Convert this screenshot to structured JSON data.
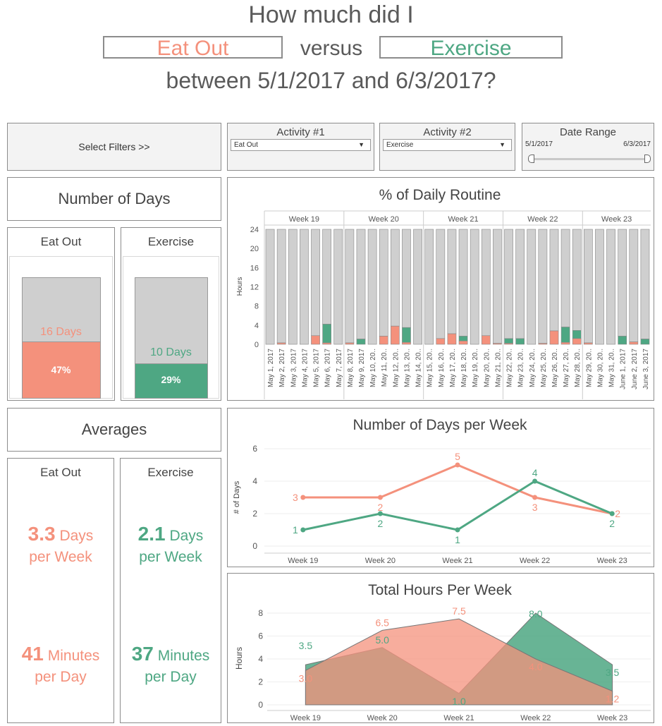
{
  "header": {
    "line1": "How much did I",
    "activity1": "Eat Out",
    "versus": "versus",
    "activity2": "Exercise",
    "line3": "between 5/1/2017 and 6/3/2017?"
  },
  "colors": {
    "eat_out": "#f4917c",
    "exercise": "#4ea783",
    "bar_gray": "#cfcfcf",
    "text": "#555555"
  },
  "filters": {
    "select_label": "Select Filters >>",
    "activity1": {
      "title": "Activity #1",
      "value": "Eat Out"
    },
    "activity2": {
      "title": "Activity #2",
      "value": "Exercise"
    },
    "date_range": {
      "title": "Date Range",
      "start": "5/1/2017",
      "end": "6/3/2017"
    }
  },
  "days": {
    "title": "Number of Days",
    "eat_out": {
      "label": "Eat Out",
      "days_text": "16 Days",
      "pct_text": "47%",
      "pct": 0.47
    },
    "exercise": {
      "label": "Exercise",
      "days_text": "10 Days",
      "pct_text": "29%",
      "pct": 0.29
    }
  },
  "averages": {
    "title": "Averages",
    "eat_out": {
      "label": "Eat Out",
      "days_num": "3.3",
      "days_unit": "Days",
      "per_week": "per Week",
      "min_num": "41",
      "min_unit": "Minutes",
      "per_day": "per Day"
    },
    "exercise": {
      "label": "Exercise",
      "days_num": "2.1",
      "days_unit": "Days",
      "per_week": "per Week",
      "min_num": "37",
      "min_unit": "Minutes",
      "per_day": "per Day"
    }
  },
  "chart_data": [
    {
      "type": "bar",
      "title": "% of Daily Routine",
      "ylabel": "Hours",
      "ylim": [
        0,
        24
      ],
      "yticks": [
        0,
        4,
        8,
        12,
        16,
        20,
        24
      ],
      "weeks": [
        {
          "label": "Week 19",
          "days": 7
        },
        {
          "label": "Week 20",
          "days": 7
        },
        {
          "label": "Week 21",
          "days": 7
        },
        {
          "label": "Week 22",
          "days": 7
        },
        {
          "label": "Week 23",
          "days": 6
        }
      ],
      "categories": [
        "May 1, 2017",
        "May 2, 2017",
        "May 3, 2017",
        "May 4, 2017",
        "May 5, 2017",
        "May 6, 2017",
        "May 7, 2017",
        "May 8, 2017",
        "May 9, 2017",
        "May 10, 20..",
        "May 11, 20..",
        "May 12, 20..",
        "May 13, 20..",
        "May 14, 20..",
        "May 15, 20..",
        "May 16, 20..",
        "May 17, 20..",
        "May 18, 20..",
        "May 19, 20..",
        "May 20, 20..",
        "May 21, 20..",
        "May 22, 20..",
        "May 23, 20..",
        "May 24, 20..",
        "May 25, 20..",
        "May 26, 20..",
        "May 27, 20..",
        "May 28, 20..",
        "May 29, 20..",
        "May 30, 20..",
        "May 31, 20..",
        "June 1, 2017",
        "June 2, 2017",
        "June 3, 2017"
      ],
      "series": [
        {
          "name": "Eat Out",
          "values": [
            0,
            0.3,
            0,
            0,
            1.8,
            0.3,
            0,
            0.3,
            0,
            0,
            1.7,
            3.8,
            0.4,
            0,
            0,
            1.2,
            2.2,
            0.7,
            0,
            1.8,
            0.2,
            0.2,
            0,
            0,
            0.2,
            2.8,
            0.4,
            1.2,
            0.3,
            0,
            0,
            0,
            0.5,
            0
          ]
        },
        {
          "name": "Exercise",
          "values": [
            0,
            0,
            0,
            0,
            0,
            3.9,
            0,
            0,
            1.1,
            0,
            0,
            0,
            3.1,
            0,
            0,
            0,
            0,
            1.0,
            0,
            0,
            0,
            1.0,
            1.2,
            0,
            0,
            0,
            3.2,
            1.7,
            0,
            0,
            0,
            1.7,
            0,
            1.1
          ]
        }
      ]
    },
    {
      "type": "line",
      "title": "Number of Days per Week",
      "ylabel": "# of Days",
      "ylim": [
        0,
        6
      ],
      "yticks": [
        0,
        2,
        4,
        6
      ],
      "categories": [
        "Week 19",
        "Week 20",
        "Week 21",
        "Week 22",
        "Week 23"
      ],
      "series": [
        {
          "name": "Eat Out",
          "values": [
            3,
            3,
            5,
            3,
            2
          ],
          "labels": [
            "3",
            "2",
            "5",
            "3",
            "2"
          ]
        },
        {
          "name": "Exercise",
          "values": [
            1,
            2,
            1,
            4,
            2
          ],
          "labels": [
            "1",
            "2",
            "1",
            "4",
            "2"
          ]
        }
      ]
    },
    {
      "type": "area",
      "title": "Total Hours Per Week",
      "ylabel": "Hours",
      "ylim": [
        0,
        8
      ],
      "yticks": [
        0,
        2,
        4,
        6,
        8
      ],
      "categories": [
        "Week 19",
        "Week 20",
        "Week 21",
        "Week 22",
        "Week 23"
      ],
      "series": [
        {
          "name": "Eat Out",
          "values": [
            3.0,
            6.5,
            7.5,
            4.0,
            1.2
          ],
          "labels": [
            "3.0",
            "6.5",
            "7.5",
            "4.0",
            "1.2"
          ]
        },
        {
          "name": "Exercise",
          "values": [
            3.5,
            5.0,
            1.0,
            8.0,
            3.5
          ],
          "labels": [
            "3.5",
            "5.0",
            "1.0",
            "8.0",
            "3.5"
          ]
        }
      ]
    }
  ]
}
